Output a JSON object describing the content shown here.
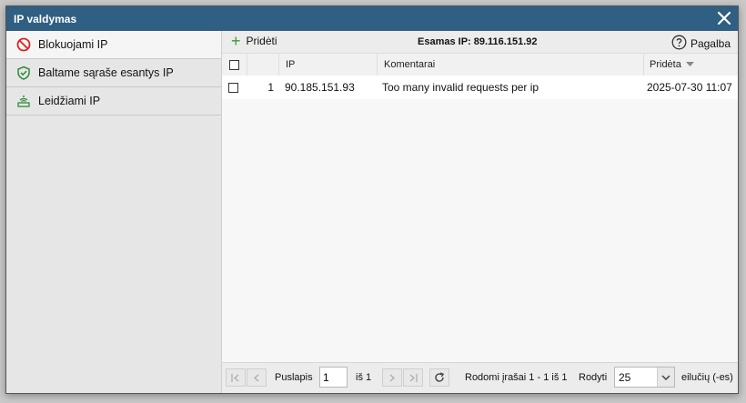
{
  "window": {
    "title": "IP valdymas"
  },
  "sidebar": {
    "items": [
      {
        "label": "Blokuojami IP",
        "icon": "block-icon",
        "active": true
      },
      {
        "label": "Baltame sąraše esantys IP",
        "icon": "shield-icon"
      },
      {
        "label": "Leidžiami IP",
        "icon": "router-icon"
      }
    ]
  },
  "toolbar": {
    "add_label": "Pridėti",
    "current_ip": "Esamas IP: 89.116.151.92",
    "help_label": "Pagalba"
  },
  "table": {
    "columns": {
      "ip": "IP",
      "comment": "Komentarai",
      "added": "Pridėta"
    },
    "rows": [
      {
        "num": "1",
        "ip": "90.185.151.93",
        "comment": "Too many invalid requests per ip",
        "added": "2025-07-30 11:07"
      }
    ]
  },
  "pagination": {
    "page_label": "Puslapis",
    "page_value": "1",
    "of_label": "iš 1",
    "records_text": "Rodomi įrašai 1 - 1 iš 1",
    "show_label": "Rodyti",
    "per_page": "25",
    "rows_label": "eilučių (-es)"
  },
  "colors": {
    "titlebar": "#2f5f82",
    "block_red": "#d22",
    "shield_green": "#2e8b3a",
    "add_green": "#3a9a3a"
  }
}
